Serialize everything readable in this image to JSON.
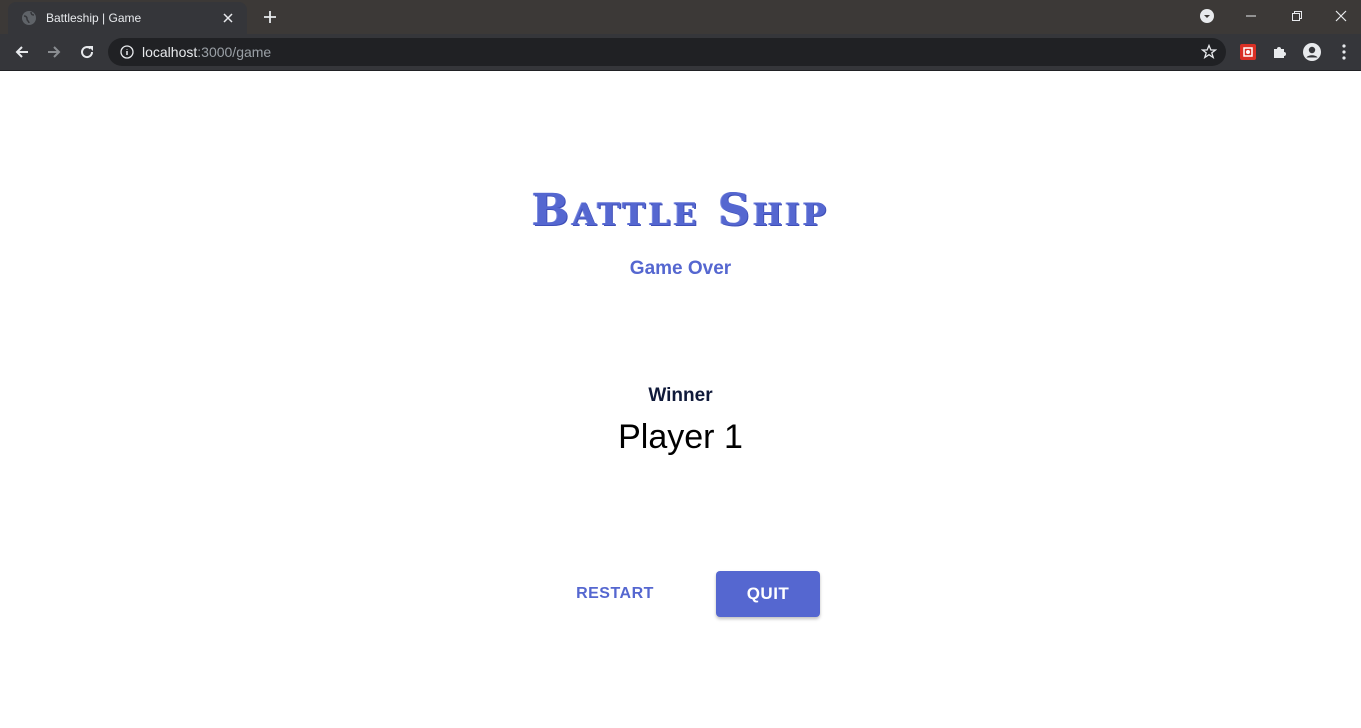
{
  "browser": {
    "tab_title": "Battleship | Game",
    "url_host": "localhost",
    "url_path": ":3000/game"
  },
  "page": {
    "logo_text": "Battle Ship",
    "subtitle": "Game Over",
    "winner_label": "Winner",
    "winner_name": "Player 1",
    "restart_label": "RESTART",
    "quit_label": "QUIT"
  },
  "colors": {
    "accent": "#5567d0",
    "chrome_dark": "#35363a",
    "tabstrip": "#3c3937"
  },
  "icons": {
    "favicon": "globe-icon",
    "tab_close": "close-icon",
    "new_tab": "plus-icon",
    "back": "arrow-left-icon",
    "forward": "arrow-right-icon",
    "reload": "reload-icon",
    "site_info": "info-icon",
    "bookmark": "star-icon",
    "extension_red": "extension-icon",
    "extensions": "puzzle-icon",
    "profile": "profile-icon",
    "menu": "kebab-menu-icon"
  }
}
